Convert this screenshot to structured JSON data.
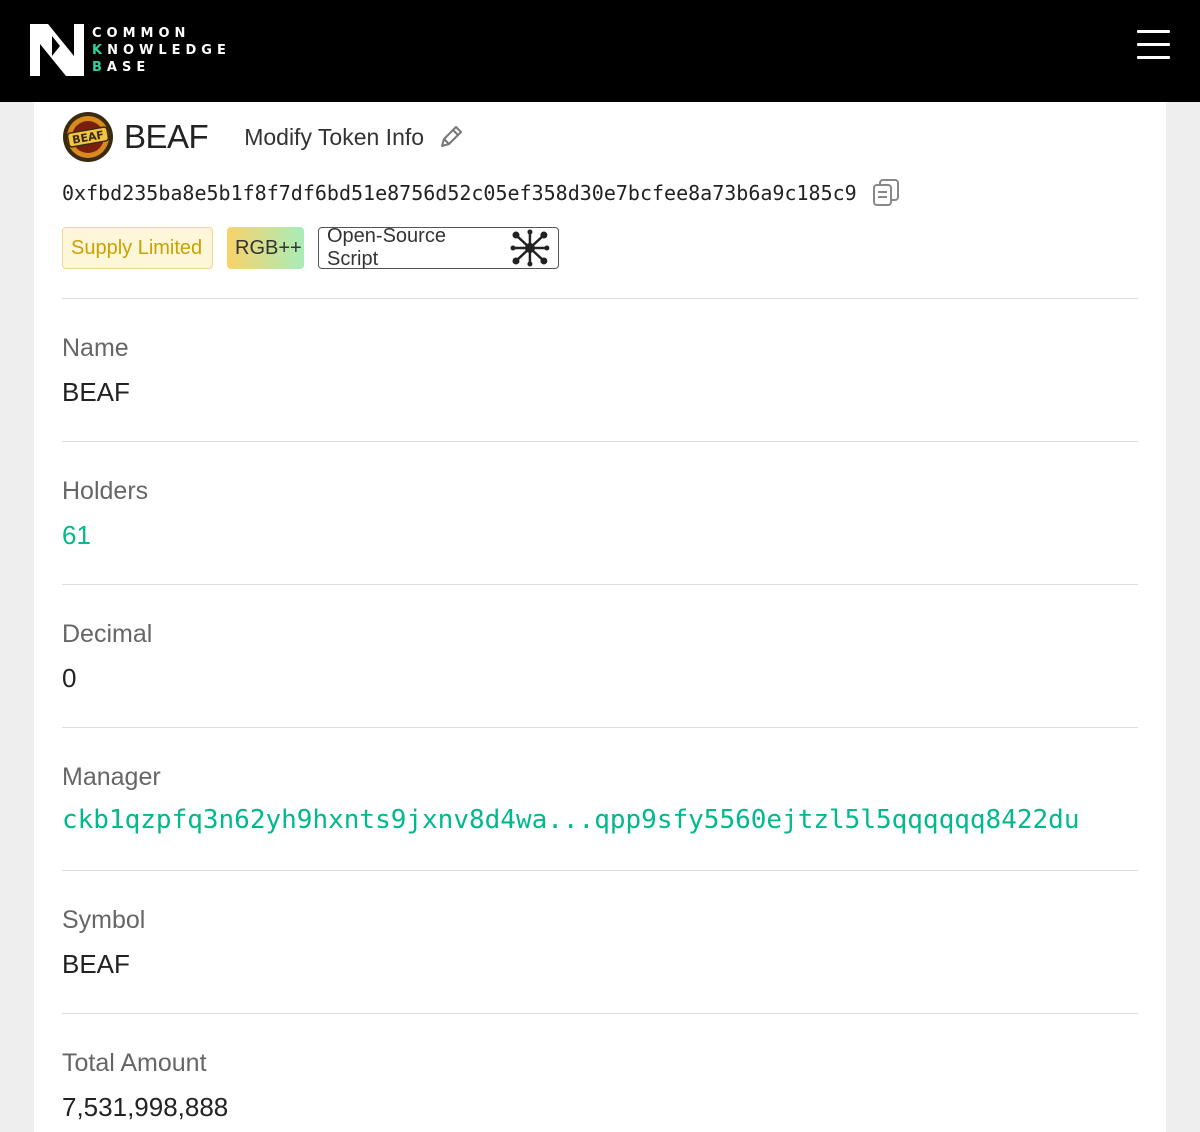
{
  "header": {
    "logo_line1": "COMMON",
    "logo_line2_accent": "K",
    "logo_line2_rest": "NOWLEDGE",
    "logo_line3_accent": "B",
    "logo_line3_rest": "ASE",
    "accent_color": "#2fd1a0",
    "menu_icon": "hamburger-icon"
  },
  "token": {
    "logo_text": "BEAF",
    "symbol": "BEAF",
    "modify_label": "Modify Token Info",
    "type_hash": "0xfbd235ba8e5b1f8f7df6bd51e8756d52c05ef358d30e7bcfee8a73b6a9c185c9",
    "tags": {
      "supply": "Supply Limited",
      "rgb": "RGB++",
      "open_source": "Open-Source Script"
    }
  },
  "fields": [
    {
      "label": "Name",
      "value": "BEAF"
    },
    {
      "label": "Holders",
      "value": "61"
    },
    {
      "label": "Decimal",
      "value": "0"
    },
    {
      "label": "Manager",
      "value": "ckb1qzpfq3n62yh9hxnts9jxnv8d4wa...qpp9sfy5560ejtzl5l5qqqqqq8422du"
    },
    {
      "label": "Symbol",
      "value": "BEAF"
    },
    {
      "label": "Total Amount",
      "value": "7,531,998,888"
    }
  ],
  "colors": {
    "link": "#00b98d",
    "supply_tag_text": "#c9a100",
    "supply_tag_bg": "#fdf6d8"
  }
}
